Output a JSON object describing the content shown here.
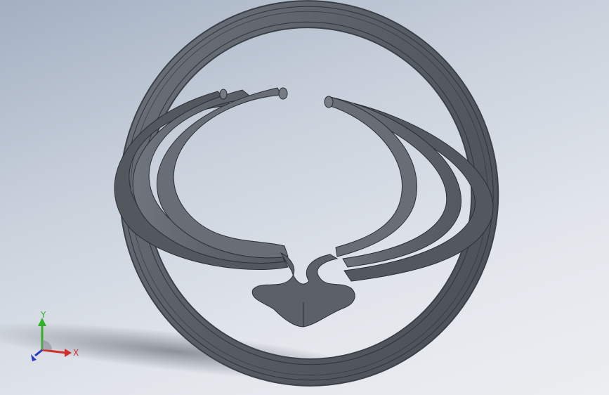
{
  "viewport": {
    "background_top": "#a3b0c2",
    "background_bottom": "#eceef1",
    "model_color": "#5d626b"
  },
  "triad": {
    "x_label": "X",
    "y_label": "Y",
    "x_color": "#d0302a",
    "y_color": "#33b02a",
    "z_color": "#2a36c8"
  }
}
